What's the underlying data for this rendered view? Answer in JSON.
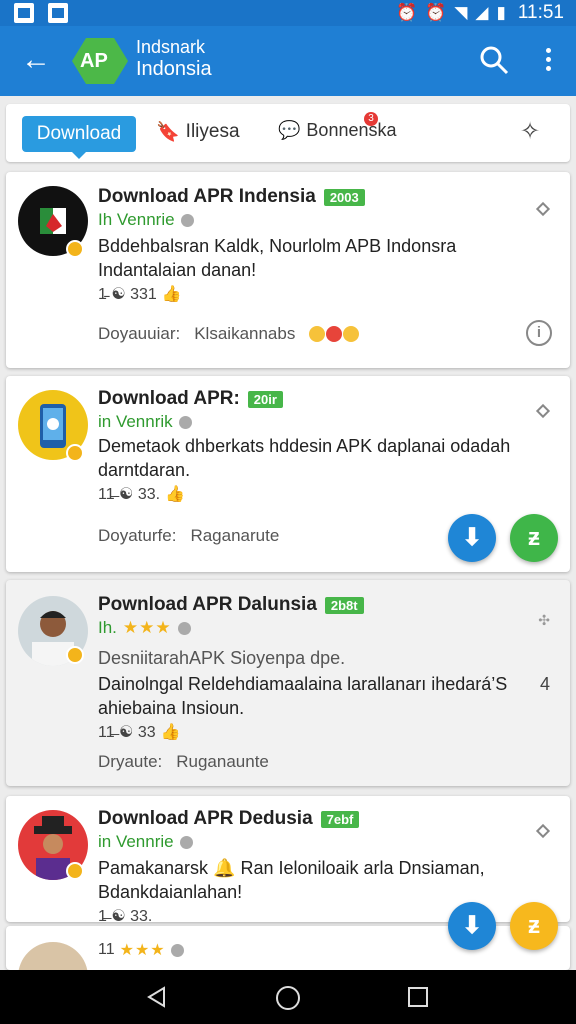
{
  "status_bar": {
    "time": "11:51",
    "icons": [
      "alarm-icon",
      "alarm-icon",
      "wifi-icon",
      "signal-icon",
      "battery-icon"
    ]
  },
  "app_bar": {
    "logo_text": "AP",
    "title_line1": "Indsnark",
    "title_line2": "Indonsia",
    "colors": {
      "bar": "#1f7fd4",
      "logo": "#4cb848"
    }
  },
  "tabs": {
    "download": "Download",
    "tab2": "Iliyesa",
    "tab3": "Bonnenska",
    "tab3_badge": "3"
  },
  "cards": [
    {
      "title": "Download APR Indensia",
      "tag": "2003",
      "dev": "Ih Vennrie",
      "desc": "Bddehbalsran Kaldk,  Nourlolm APB  Indonsra Indantalaian danan!",
      "stats": "1̵ ☯ 331",
      "foot_label": "Doyauuiar:",
      "foot_value": "Klsaikannabs"
    },
    {
      "title": "Download APR:",
      "tag": "20ir",
      "dev": "in Vennrik",
      "desc": "Demetaok dhberkats hddesin APK daplanai odadah darntdaran.",
      "stats": "11̶ ☯ 33.",
      "foot_label": "Doyaturfe:",
      "foot_value": "Raganarute"
    },
    {
      "title": "Pownload APR Dalunsia",
      "tag": "2b8t",
      "dev": "Ih.",
      "stars": "★★★",
      "subtitle": "DesniitarahAPK Sioyenpa  dpe.",
      "desc": "Dainolngal Reldehdiamaalaina larallanarı ihedará’S ahiebaina Insioun.",
      "side": "4",
      "stats": "11̶ ☯ 33",
      "foot_label": "Dryaute:",
      "foot_value": "Ruganaunte"
    },
    {
      "title": "Download APR Dedusia",
      "tag": "7ebf",
      "dev": "in Vennrie",
      "desc": "Pamakanarsk 🔔 Ran Ieloniloaik arla Dnsiaman, Bdankdaianlahan!",
      "stats": "1̶ ☯ 33."
    },
    {
      "stats": "11",
      "stars": "★★★"
    }
  ]
}
